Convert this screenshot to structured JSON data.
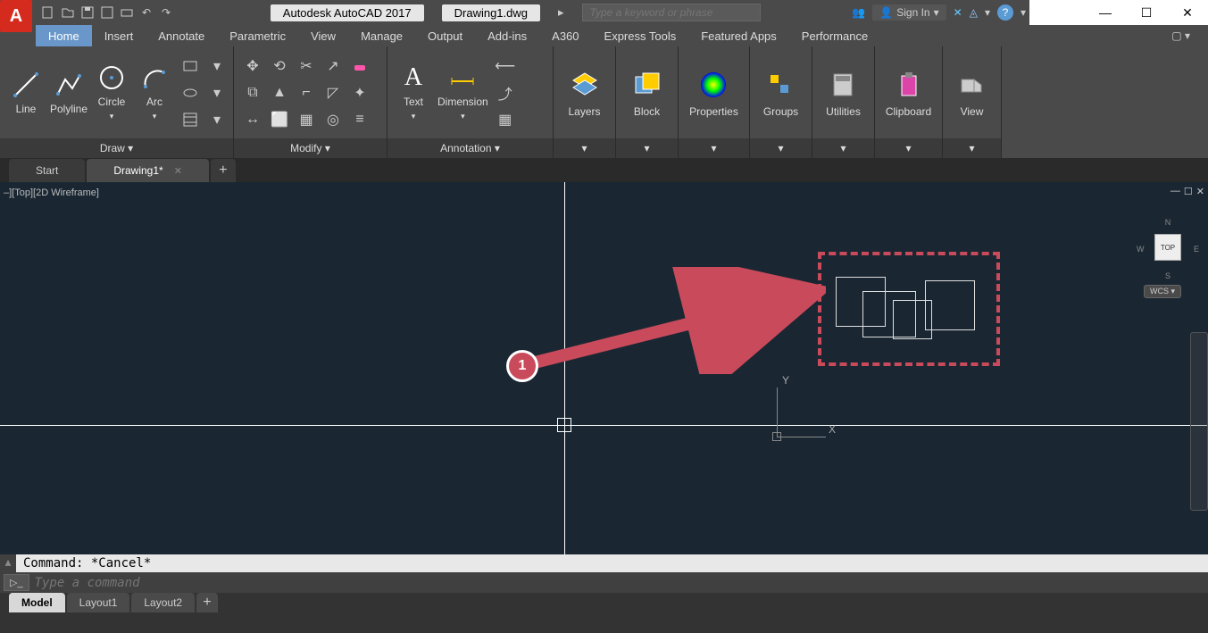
{
  "title": {
    "app": "Autodesk AutoCAD 2017",
    "file": "Drawing1.dwg"
  },
  "search": {
    "placeholder": "Type a keyword or phrase"
  },
  "signin": {
    "label": "Sign In"
  },
  "menu": {
    "tabs": [
      "Home",
      "Insert",
      "Annotate",
      "Parametric",
      "View",
      "Manage",
      "Output",
      "Add-ins",
      "A360",
      "Express Tools",
      "Featured Apps",
      "Performance"
    ],
    "active": "Home"
  },
  "ribbon": {
    "draw": {
      "title": "Draw ▾",
      "line": "Line",
      "polyline": "Polyline",
      "circle": "Circle",
      "arc": "Arc"
    },
    "modify": {
      "title": "Modify ▾"
    },
    "annotation": {
      "title": "Annotation ▾",
      "text": "Text",
      "dimension": "Dimension"
    },
    "layers": {
      "title": "▾",
      "label": "Layers"
    },
    "block": {
      "title": "▾",
      "label": "Block"
    },
    "properties": {
      "title": "▾",
      "label": "Properties"
    },
    "groups": {
      "title": "▾",
      "label": "Groups"
    },
    "utilities": {
      "title": "▾",
      "label": "Utilities"
    },
    "clipboard": {
      "title": "▾",
      "label": "Clipboard"
    },
    "view": {
      "title": "▾",
      "label": "View"
    }
  },
  "doc_tabs": {
    "start": "Start",
    "drawing": "Drawing1*"
  },
  "canvas": {
    "label": "–][Top][2D Wireframe]",
    "ucs": {
      "x": "X",
      "y": "Y"
    },
    "annotation_badge": "1",
    "viewcube": {
      "n": "N",
      "s": "S",
      "e": "E",
      "w": "W",
      "top": "TOP",
      "wcs": "WCS ▾"
    }
  },
  "cmd": {
    "history": "Command: *Cancel*",
    "placeholder": "Type a command"
  },
  "layout_tabs": {
    "model": "Model",
    "l1": "Layout1",
    "l2": "Layout2"
  }
}
